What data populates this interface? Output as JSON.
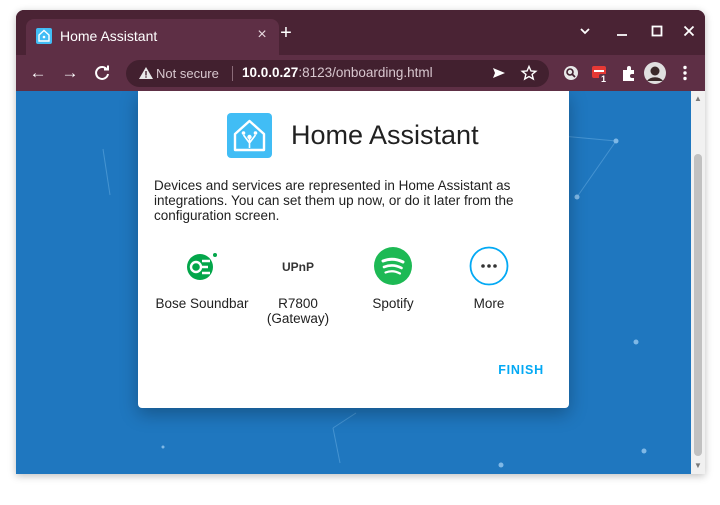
{
  "browser": {
    "tab_title": "Home Assistant",
    "tab_close": "×",
    "new_tab": "+",
    "controls": {
      "dropdown": "⌄",
      "minimize": "–",
      "maximize": "□",
      "close": "✕"
    },
    "nav": {
      "back": "←",
      "forward": "→",
      "reload": "C"
    },
    "omnibox": {
      "security_label": "Not secure",
      "url_host": "10.0.0.27",
      "url_rest": ":8123/onboarding.html"
    },
    "badge_count": "1",
    "accent_color": "#5e2f45"
  },
  "dialog": {
    "brand_title": "Home Assistant",
    "intro_text": "Devices and services are represented in Home Assistant as integrations. You can set them up now, or do it later from the configuration screen.",
    "integrations": [
      {
        "label": "Bose Soundbar",
        "icon": "bose-icon",
        "color": "#03a64a"
      },
      {
        "label": "R7800\n(Gateway)",
        "icon": "upnp-icon",
        "color": "#333333"
      },
      {
        "label": "Spotify",
        "icon": "spotify-icon",
        "color": "#1db954"
      },
      {
        "label": "More",
        "icon": "more-icon",
        "color": "#03a9f4"
      }
    ],
    "finish_label": "FINISH"
  },
  "colors": {
    "background": "#1f77bf",
    "ha_blue": "#41bdf5",
    "link": "#03a9f4"
  }
}
